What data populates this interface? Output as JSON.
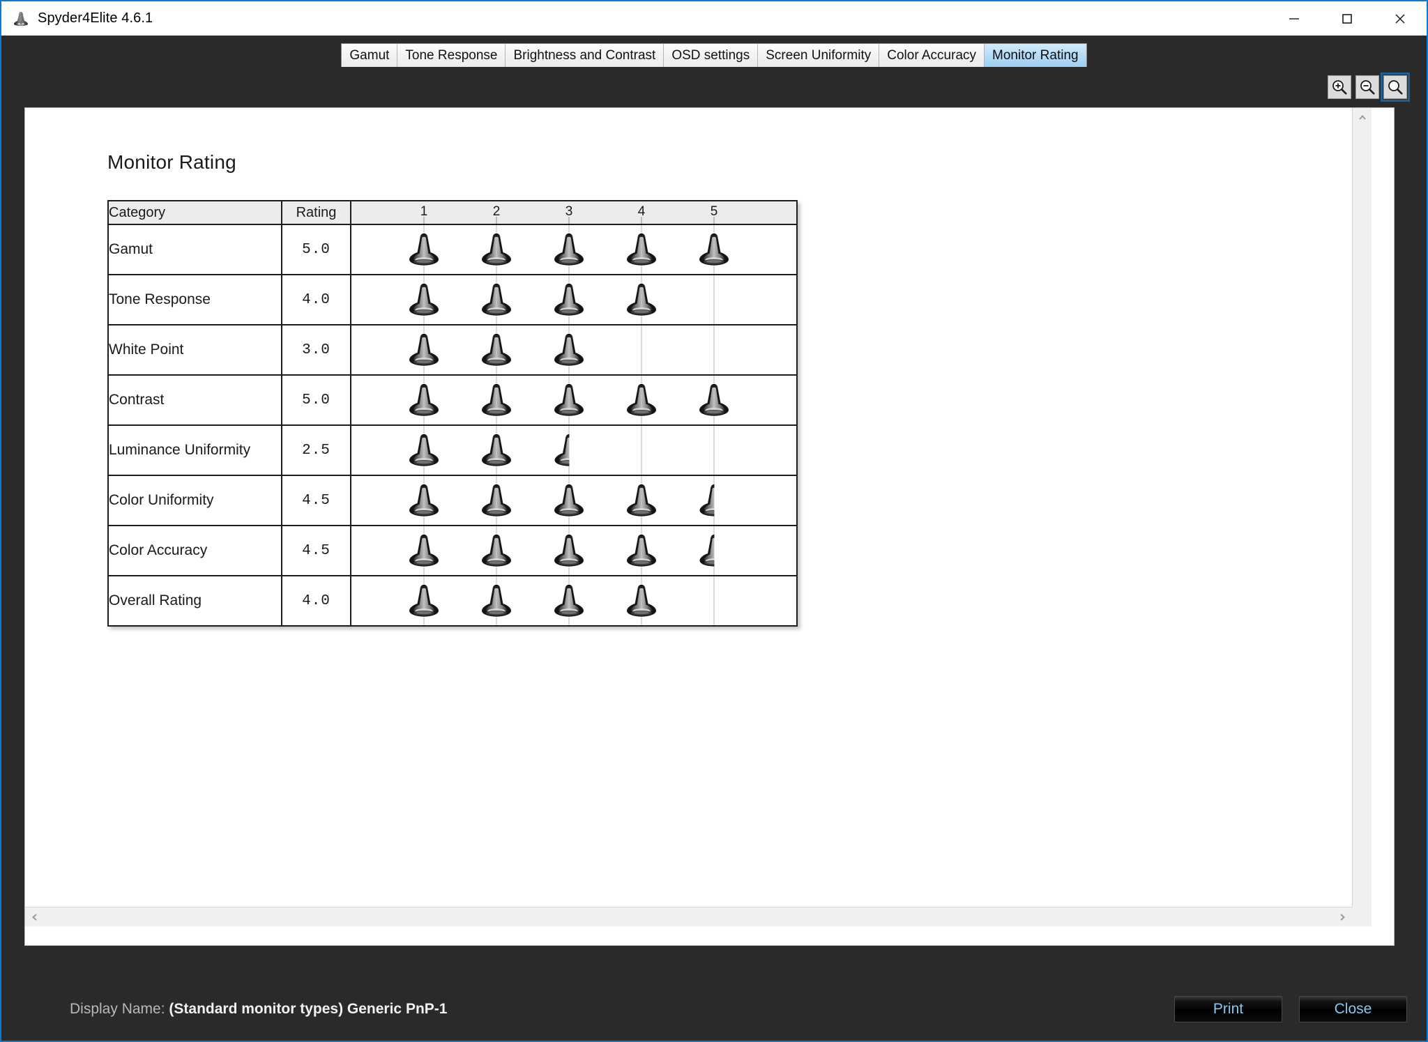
{
  "window": {
    "title": "Spyder4Elite 4.6.1",
    "app_icon": "spyder-colorimeter-icon",
    "controls": {
      "minimize": "minimize-icon",
      "maximize": "maximize-icon",
      "close": "close-icon"
    },
    "accent_border": "#0a7bd4"
  },
  "tabs": [
    {
      "label": "Gamut",
      "selected": false
    },
    {
      "label": "Tone Response",
      "selected": false
    },
    {
      "label": "Brightness and Contrast",
      "selected": false
    },
    {
      "label": "OSD settings",
      "selected": false
    },
    {
      "label": "Screen Uniformity",
      "selected": false
    },
    {
      "label": "Color Accuracy",
      "selected": false
    },
    {
      "label": "Monitor Rating",
      "selected": true
    }
  ],
  "toolbar": {
    "zoom_in": "zoom-in-icon",
    "zoom_out": "zoom-out-icon",
    "zoom_reset": "zoom-reset-icon",
    "active": "zoom_reset"
  },
  "report": {
    "title": "Monitor Rating",
    "table": {
      "headers": {
        "category": "Category",
        "rating": "Rating",
        "scale": [
          "1",
          "2",
          "3",
          "4",
          "5"
        ]
      },
      "rows": [
        {
          "category": "Gamut",
          "rating": "5.0",
          "value": 5.0
        },
        {
          "category": "Tone Response",
          "rating": "4.0",
          "value": 4.0
        },
        {
          "category": "White Point",
          "rating": "3.0",
          "value": 3.0
        },
        {
          "category": "Contrast",
          "rating": "5.0",
          "value": 5.0
        },
        {
          "category": "Luminance Uniformity",
          "rating": "2.5",
          "value": 2.5
        },
        {
          "category": "Color Uniformity",
          "rating": "4.5",
          "value": 4.5
        },
        {
          "category": "Color Accuracy",
          "rating": "4.5",
          "value": 4.5
        },
        {
          "category": "Overall Rating",
          "rating": "4.0",
          "value": 4.0
        }
      ]
    }
  },
  "chart_data": {
    "type": "bar",
    "title": "Monitor Rating",
    "xlabel": "",
    "ylabel": "",
    "xlim": [
      0,
      5
    ],
    "categories": [
      "Gamut",
      "Tone Response",
      "White Point",
      "Contrast",
      "Luminance Uniformity",
      "Color Uniformity",
      "Color Accuracy",
      "Overall Rating"
    ],
    "values": [
      5.0,
      4.0,
      3.0,
      5.0,
      2.5,
      4.5,
      4.5,
      4.0
    ],
    "tick_labels": [
      "1",
      "2",
      "3",
      "4",
      "5"
    ],
    "grid": true,
    "legend": "none",
    "notes": "Horizontal pictograph rating: each unit drawn as a Spyder colorimeter glyph; half values drawn as left half glyph; max 5."
  },
  "scrollbars": {
    "vertical_up": "chevron-up-icon",
    "vertical_down": "chevron-down-icon",
    "horizontal_left": "chevron-left-icon",
    "horizontal_right": "chevron-right-icon"
  },
  "footer": {
    "display_name_label": "Display Name:",
    "display_name_value": "(Standard monitor types) Generic PnP-1",
    "print_label": "Print",
    "close_label": "Close"
  }
}
